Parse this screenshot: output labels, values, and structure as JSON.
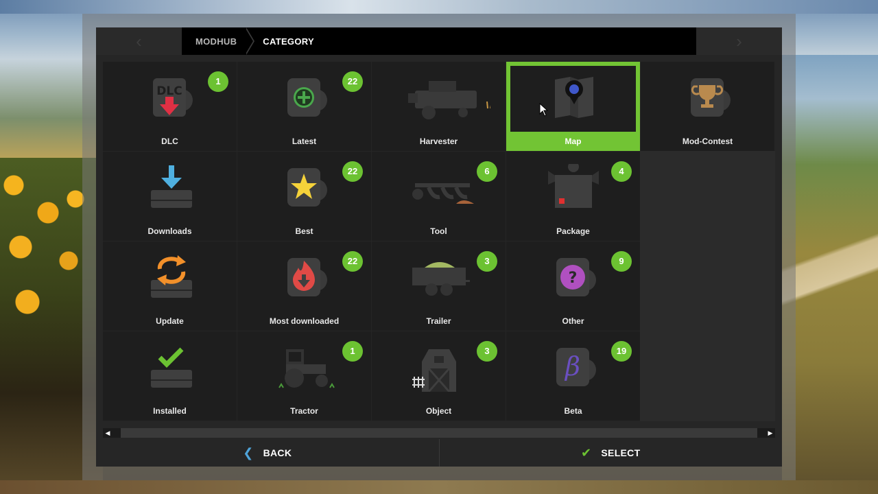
{
  "breadcrumb": {
    "root": "MODHUB",
    "current": "CATEGORY"
  },
  "header": {
    "prev_arrow": "‹",
    "next_arrow": "›"
  },
  "tiles": [
    {
      "label": "DLC",
      "badge": "1",
      "icon": "dlc-download-icon"
    },
    {
      "label": "Latest",
      "badge": "22",
      "icon": "plus-icon"
    },
    {
      "label": "Harvester",
      "badge": "",
      "icon": "harvester-icon"
    },
    {
      "label": "Map",
      "badge": "",
      "icon": "map-pin-icon",
      "selected": true
    },
    {
      "label": "Mod-Contest",
      "badge": "",
      "icon": "trophy-icon"
    },
    {
      "label": "Downloads",
      "badge": "",
      "icon": "download-tray-icon"
    },
    {
      "label": "Best",
      "badge": "22",
      "icon": "star-icon"
    },
    {
      "label": "Tool",
      "badge": "6",
      "icon": "plough-icon"
    },
    {
      "label": "Package",
      "badge": "4",
      "icon": "package-icon"
    },
    {
      "label": "Update",
      "badge": "",
      "icon": "update-sync-icon"
    },
    {
      "label": "Most downloaded",
      "badge": "22",
      "icon": "flame-download-icon"
    },
    {
      "label": "Trailer",
      "badge": "3",
      "icon": "trailer-icon"
    },
    {
      "label": "Other",
      "badge": "9",
      "icon": "question-icon"
    },
    {
      "label": "Installed",
      "badge": "",
      "icon": "installed-check-icon"
    },
    {
      "label": "Tractor",
      "badge": "1",
      "icon": "tractor-icon"
    },
    {
      "label": "Object",
      "badge": "3",
      "icon": "barn-icon"
    },
    {
      "label": "Beta",
      "badge": "19",
      "icon": "beta-icon"
    }
  ],
  "footer": {
    "back_label": "BACK",
    "select_label": "SELECT"
  },
  "colors": {
    "accent_green": "#72c434",
    "badge_green": "#6cc232",
    "back_blue": "#4fa3d9"
  }
}
